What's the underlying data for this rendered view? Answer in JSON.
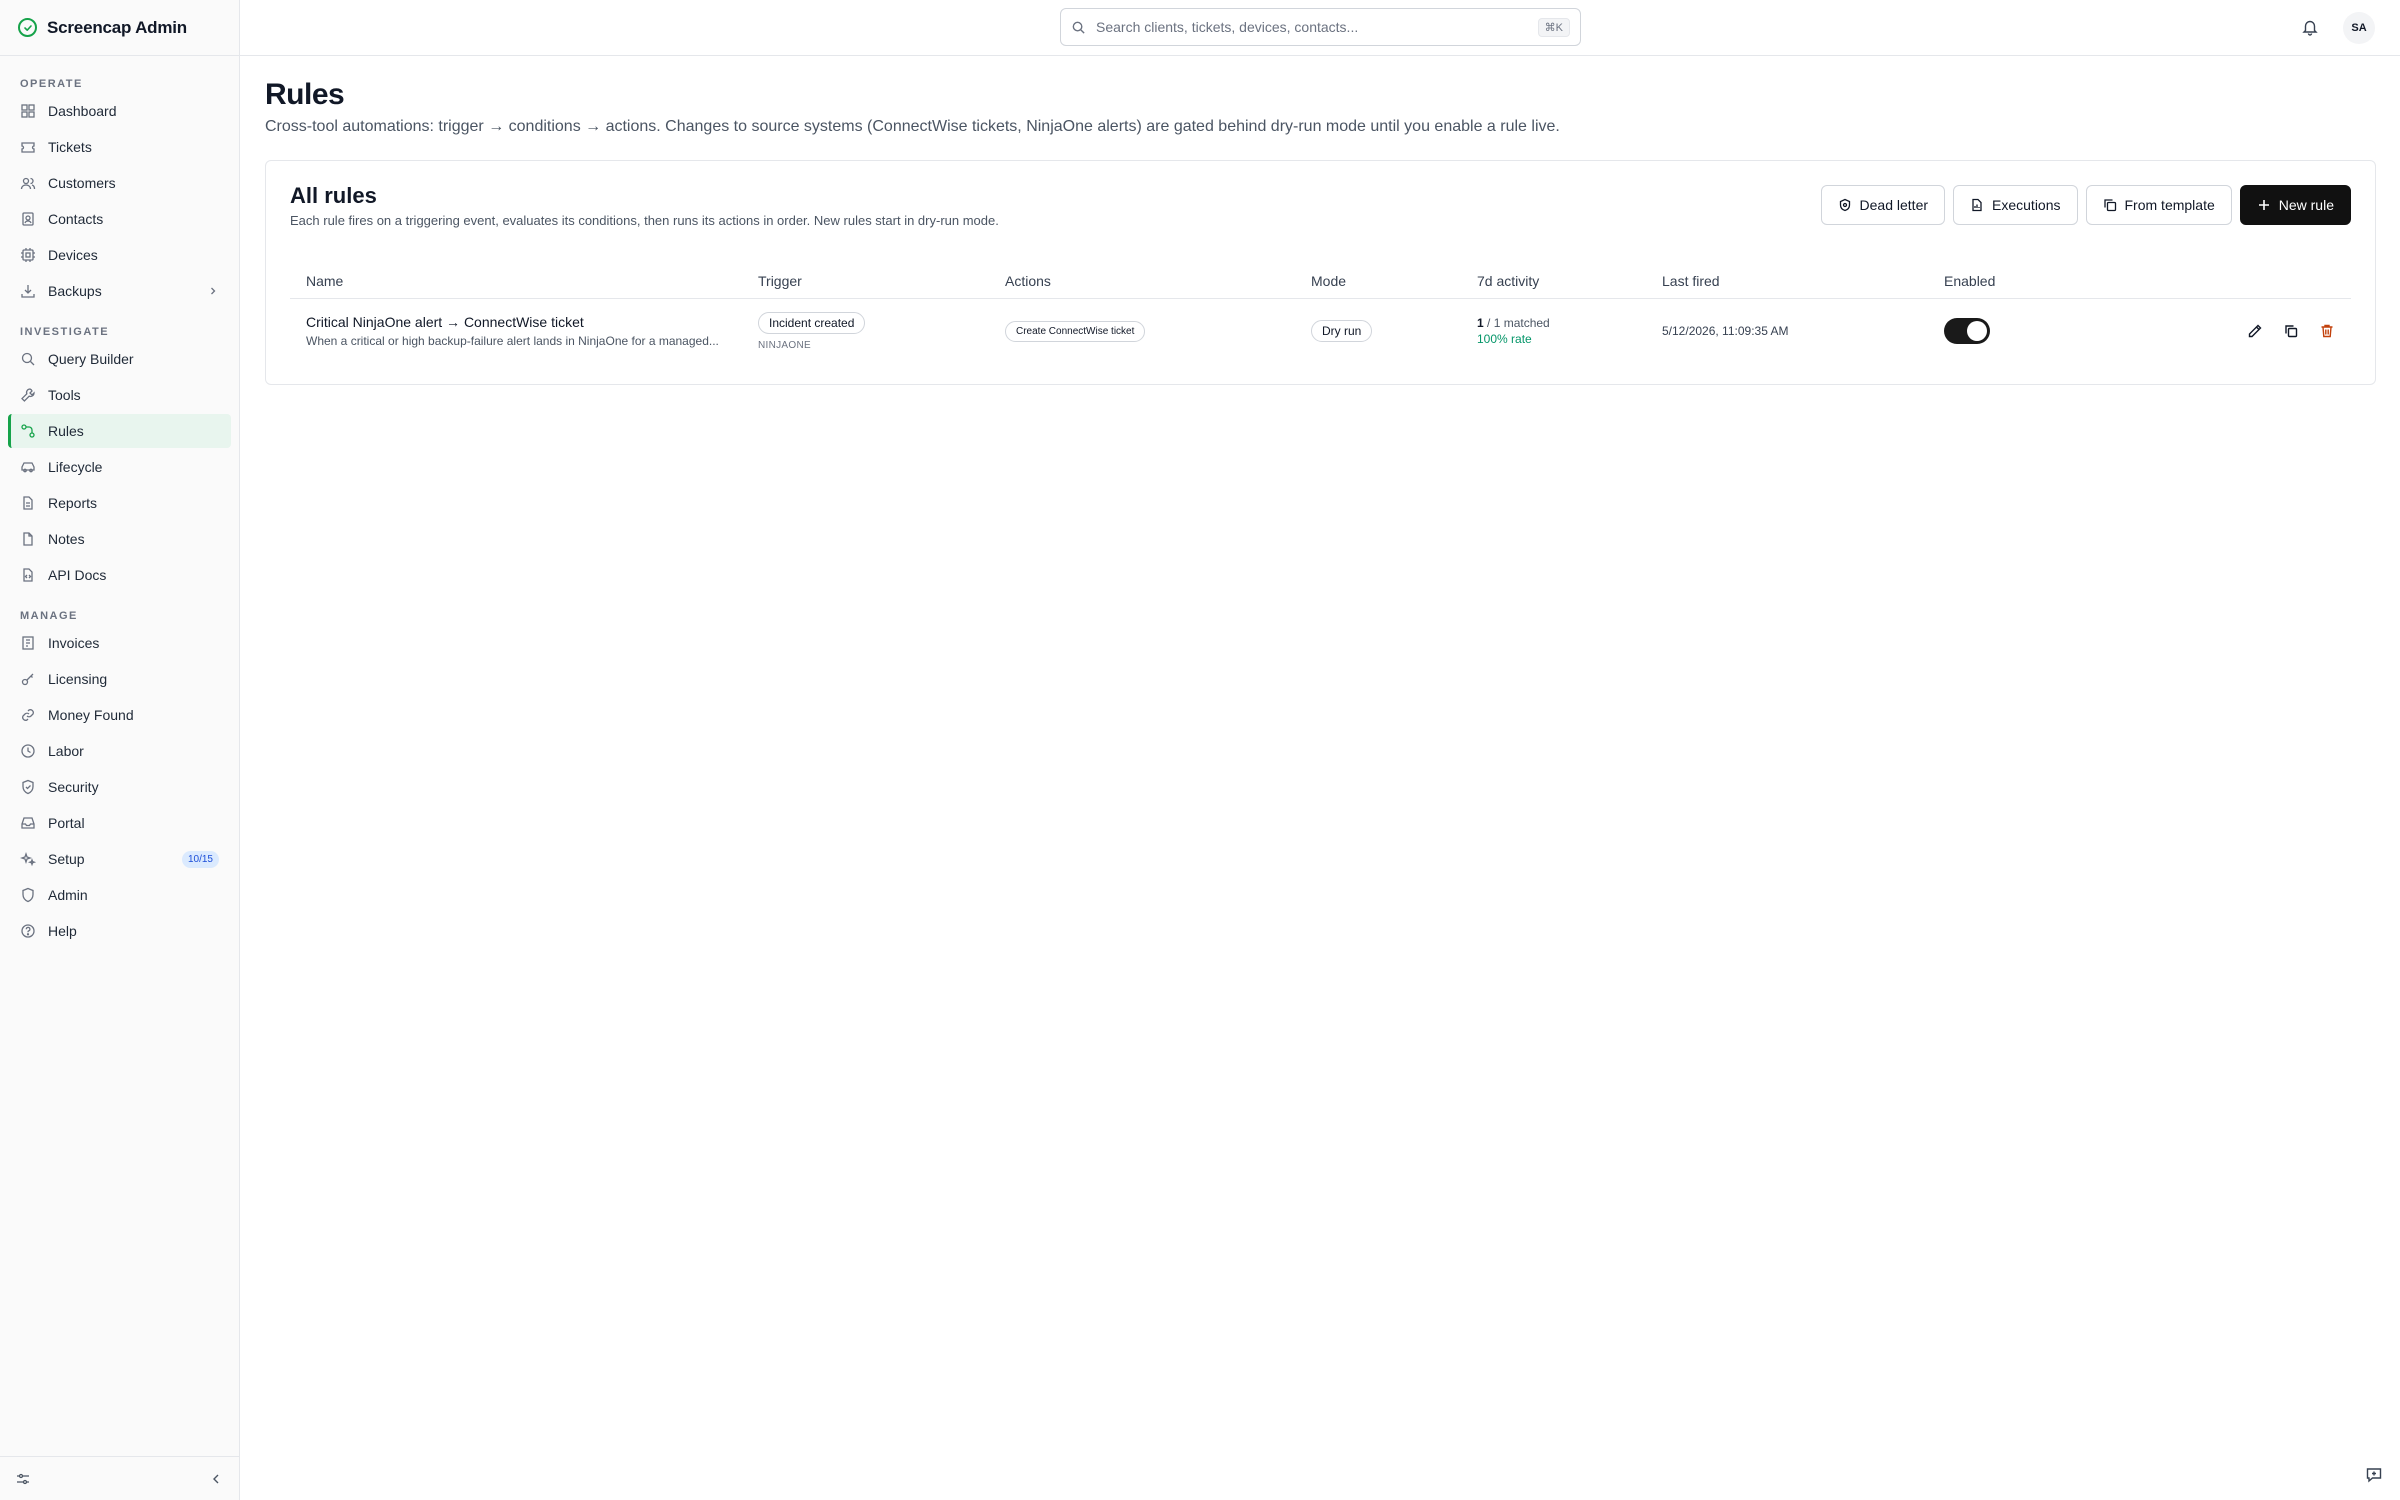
{
  "app": {
    "name": "Screencap Admin"
  },
  "sidebar": {
    "sections": [
      {
        "label": "OPERATE",
        "items": [
          {
            "label": "Dashboard",
            "icon": "grid-icon"
          },
          {
            "label": "Tickets",
            "icon": "ticket-icon"
          },
          {
            "label": "Customers",
            "icon": "users-icon"
          },
          {
            "label": "Contacts",
            "icon": "contact-icon"
          },
          {
            "label": "Devices",
            "icon": "device-icon"
          },
          {
            "label": "Backups",
            "icon": "download-icon"
          }
        ]
      },
      {
        "label": "INVESTIGATE",
        "items": [
          {
            "label": "Query Builder",
            "icon": "search-icon"
          },
          {
            "label": "Tools",
            "icon": "wrench-icon"
          },
          {
            "label": "Rules",
            "icon": "workflow-icon"
          },
          {
            "label": "Lifecycle",
            "icon": "car-icon"
          },
          {
            "label": "Reports",
            "icon": "file-icon"
          },
          {
            "label": "Notes",
            "icon": "note-icon"
          },
          {
            "label": "API Docs",
            "icon": "code-file-icon"
          }
        ]
      },
      {
        "label": "MANAGE",
        "items": [
          {
            "label": "Invoices",
            "icon": "receipt-icon"
          },
          {
            "label": "Licensing",
            "icon": "key-icon"
          },
          {
            "label": "Money Found",
            "icon": "link-icon"
          },
          {
            "label": "Labor",
            "icon": "clock-icon"
          },
          {
            "label": "Security",
            "icon": "shield-icon"
          },
          {
            "label": "Portal",
            "icon": "inbox-icon"
          },
          {
            "label": "Setup",
            "icon": "sparkles-icon",
            "badge": "10/15"
          },
          {
            "label": "Admin",
            "icon": "shield-outline-icon"
          },
          {
            "label": "Help",
            "icon": "help-icon"
          }
        ]
      }
    ],
    "active": "Rules"
  },
  "topbar": {
    "search_placeholder": "Search clients, tickets, devices, contacts...",
    "shortcut": "⌘K",
    "avatar_initials": "SA"
  },
  "page": {
    "title": "Rules",
    "subtitle": "Cross-tool automations: trigger → conditions → actions. Changes to source systems (ConnectWise tickets, NinjaOne alerts) are gated behind dry-run mode until you enable a rule live."
  },
  "card": {
    "title": "All rules",
    "description": "Each rule fires on a triggering event, evaluates its conditions, then runs its actions in order. New rules start in dry-run mode.",
    "buttons": {
      "dead_letter": "Dead letter",
      "executions": "Executions",
      "from_template": "From template",
      "new_rule": "New rule"
    },
    "columns": [
      "Name",
      "Trigger",
      "Actions",
      "Mode",
      "7d activity",
      "Last fired",
      "Enabled",
      ""
    ],
    "rows": [
      {
        "name": "Critical NinjaOne alert → ConnectWise ticket",
        "description": "When a critical or high backup-failure alert lands in NinjaOne for a managed...",
        "trigger": "Incident created",
        "trigger_source": "NINJAONE",
        "action": "Create ConnectWise ticket",
        "mode": "Dry run",
        "activity_count": "1",
        "activity_matched": "/ 1 matched",
        "activity_rate": "100% rate",
        "last_fired": "5/12/2026, 11:09:35 AM",
        "enabled": true
      }
    ]
  },
  "colors": {
    "accent": "#16a34a",
    "primary_button": "#111111",
    "delete": "#c2410c",
    "rate": "#059669"
  }
}
